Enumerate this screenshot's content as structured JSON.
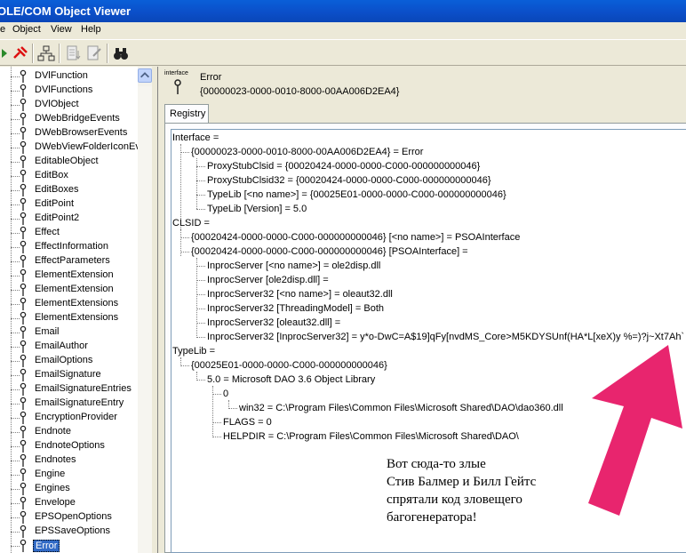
{
  "window": {
    "title": "OLE/COM Object Viewer"
  },
  "menu": {
    "items": [
      "Object",
      "View",
      "Help"
    ],
    "cutoff_label": "e"
  },
  "toolbar": {
    "icons": [
      "refresh-icon",
      "pin-icon",
      "tree-icon",
      "view-icon",
      "edit-icon",
      "binoculars-icon"
    ]
  },
  "tree": {
    "items": [
      "DVlFunction",
      "DVlFunctions",
      "DVlObject",
      "DWebBridgeEvents",
      "DWebBrowserEvents",
      "DWebViewFolderIconEv",
      "EditableObject",
      "EditBox",
      "EditBoxes",
      "EditPoint",
      "EditPoint2",
      "Effect",
      "EffectInformation",
      "EffectParameters",
      "ElementExtension",
      "ElementExtension",
      "ElementExtensions",
      "ElementExtensions",
      "Email",
      "EmailAuthor",
      "EmailOptions",
      "EmailSignature",
      "EmailSignatureEntries",
      "EmailSignatureEntry",
      "EncryptionProvider",
      "Endnote",
      "EndnoteOptions",
      "Endnotes",
      "Engine",
      "Engines",
      "Envelope",
      "EPSOpenOptions",
      "EPSSaveOptions",
      "Error"
    ],
    "selected_index": 33
  },
  "detail": {
    "icon_label": "interface",
    "name": "Error",
    "guid": "{00000023-0000-0010-8000-00AA006D2EA4}",
    "tab": "Registry"
  },
  "registry": [
    "Interface =",
    "{00000023-0000-0010-8000-00AA006D2EA4} = Error",
    "ProxyStubClsid = {00020424-0000-0000-C000-000000000046}",
    "ProxyStubClsid32 = {00020424-0000-0000-C000-000000000046}",
    "TypeLib [<no name>] = {00025E01-0000-0000-C000-000000000046}",
    "TypeLib [Version] = 5.0",
    "CLSID =",
    "{00020424-0000-0000-C000-000000000046} [<no name>] = PSOAInterface",
    "{00020424-0000-0000-C000-000000000046} [PSOAInterface] =",
    "InprocServer [<no name>] = ole2disp.dll",
    "InprocServer [ole2disp.dll] =",
    "InprocServer32 [<no name>] = oleaut32.dll",
    "InprocServer32 [ThreadingModel] = Both",
    "InprocServer32 [oleaut32.dll] =",
    "InprocServer32 [InprocServer32] = y*o-DwC=A$19]qFy[nvdMS_Core>M5KDYSUnf(HA*L[xeX)y %=)?j~Xt7Ah`",
    "TypeLib =",
    "{00025E01-0000-0000-C000-000000000046}",
    "5.0 = Microsoft DAO 3.6 Object Library",
    "0",
    "win32 = C:\\Program Files\\Common Files\\Microsoft Shared\\DAO\\dao360.dll",
    "FLAGS = 0",
    "HELPDIR = C:\\Program Files\\Common Files\\Microsoft Shared\\DAO\\"
  ],
  "annotation": {
    "line1": "Вот сюда-то злые",
    "line2": "Стив Балмер и Билл Гейтс",
    "line3": "спрятали код зловещего",
    "line4": "багогенератора!",
    "arrow_color": "#e8256e"
  }
}
